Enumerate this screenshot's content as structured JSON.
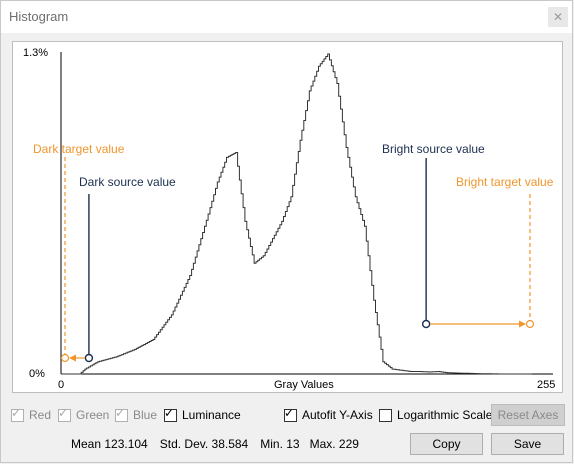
{
  "window": {
    "title": "Histogram",
    "close_label": "✕"
  },
  "axis": {
    "y_max_label": "1.3%",
    "y_min_label": "0%",
    "x_min_label": "0",
    "x_max_label": "255",
    "x_title": "Gray Values"
  },
  "annotations": {
    "dark_target": "Dark target value",
    "dark_source": "Dark source value",
    "bright_source": "Bright source value",
    "bright_target": "Bright target value"
  },
  "colors": {
    "orange": "#f0962d",
    "navy": "#1c2f50"
  },
  "channels": [
    {
      "label": "Red",
      "checked": true,
      "enabled": false
    },
    {
      "label": "Green",
      "checked": true,
      "enabled": false
    },
    {
      "label": "Blue",
      "checked": true,
      "enabled": false
    },
    {
      "label": "Luminance",
      "checked": true,
      "enabled": true
    }
  ],
  "options": {
    "autofit_label": "Autofit Y-Axis",
    "autofit_checked": true,
    "log_label": "Logarithmic Scale",
    "log_checked": false,
    "reset_label": "Reset Axes"
  },
  "stats": {
    "mean": "Mean 123.104",
    "std": "Std. Dev. 38.584",
    "min": "Min. 13",
    "max": "Max. 229"
  },
  "buttons": {
    "copy": "Copy",
    "save": "Save"
  },
  "chart_data": {
    "type": "area",
    "xlabel": "Gray Values",
    "ylabel": "",
    "xlim": [
      0,
      255
    ],
    "ylim": [
      0,
      1.3
    ],
    "x": [
      0,
      10,
      13,
      20,
      30,
      40,
      50,
      60,
      70,
      80,
      85,
      90,
      95,
      100,
      105,
      110,
      115,
      120,
      125,
      130,
      135,
      140,
      145,
      150,
      155,
      160,
      165,
      170,
      175,
      180,
      185,
      190,
      195,
      200,
      205,
      210,
      215,
      220,
      225,
      229,
      240,
      255
    ],
    "y": [
      0,
      0,
      0.02,
      0.05,
      0.07,
      0.1,
      0.14,
      0.24,
      0.4,
      0.65,
      0.78,
      0.88,
      0.9,
      0.62,
      0.45,
      0.48,
      0.55,
      0.62,
      0.72,
      0.95,
      1.15,
      1.25,
      1.3,
      1.18,
      0.92,
      0.72,
      0.6,
      0.3,
      0.05,
      0.02,
      0.015,
      0.01,
      0.01,
      0.008,
      0.01,
      0.005,
      0.004,
      0.003,
      0.002,
      0.001,
      0,
      0
    ],
    "markers": {
      "dark_target": 0,
      "dark_source": 13,
      "bright_source": 192,
      "bright_target": 255
    }
  }
}
